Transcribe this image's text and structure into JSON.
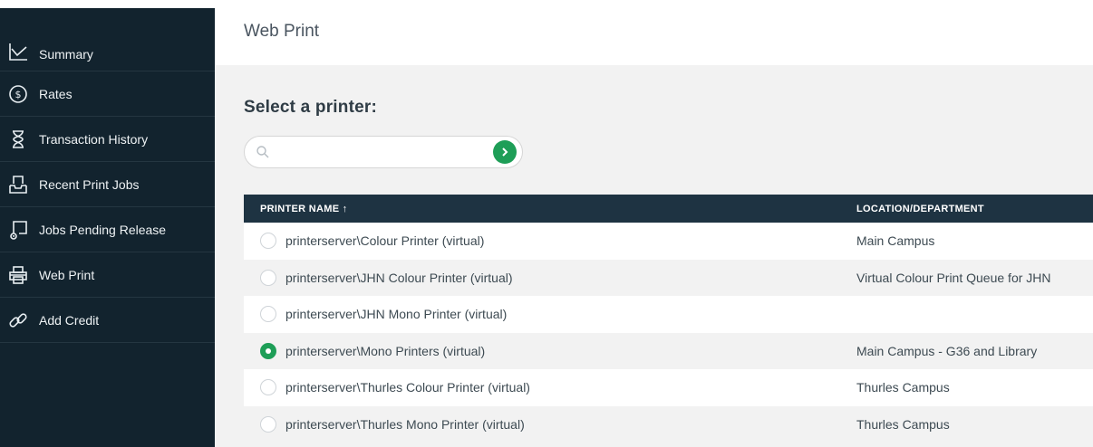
{
  "sidebar": {
    "items": [
      {
        "label": "Summary",
        "icon": "chart-line-icon"
      },
      {
        "label": "Rates",
        "icon": "dollar-circle-icon"
      },
      {
        "label": "Transaction History",
        "icon": "hourglass-icon"
      },
      {
        "label": "Recent Print Jobs",
        "icon": "inbox-tray-icon"
      },
      {
        "label": "Jobs Pending Release",
        "icon": "print-release-icon"
      },
      {
        "label": "Web Print",
        "icon": "printer-icon"
      },
      {
        "label": "Add Credit",
        "icon": "link-icon"
      }
    ]
  },
  "header": {
    "title": "Web Print"
  },
  "main": {
    "heading": "Select a printer:",
    "search": {
      "placeholder": "",
      "value": ""
    },
    "table": {
      "columns": [
        "PRINTER NAME ↑",
        "LOCATION/DEPARTMENT"
      ],
      "rows": [
        {
          "name": "printerserver\\Colour Printer (virtual)",
          "location": "Main Campus",
          "selected": false
        },
        {
          "name": "printerserver\\JHN Colour Printer (virtual)",
          "location": "Virtual Colour Print Queue for JHN",
          "selected": false
        },
        {
          "name": "printerserver\\JHN Mono Printer (virtual)",
          "location": "",
          "selected": false
        },
        {
          "name": "printerserver\\Mono Printers (virtual)",
          "location": "Main Campus - G36 and Library",
          "selected": true
        },
        {
          "name": "printerserver\\Thurles Colour Printer (virtual)",
          "location": "Thurles Campus",
          "selected": false
        },
        {
          "name": "printerserver\\Thurles Mono Printer (virtual)",
          "location": "Thurles Campus",
          "selected": false
        }
      ]
    }
  },
  "colors": {
    "sidebar_bg": "#12232e",
    "table_header_bg": "#1e3342",
    "accent_green": "#1e9e57"
  }
}
